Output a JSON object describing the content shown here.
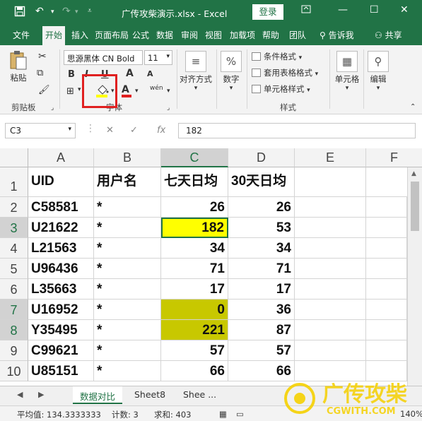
{
  "window": {
    "title": "广传攻柴演示.xlsx  -  Excel",
    "login_label": "登录",
    "undo_icon": "undo-icon",
    "redo_icon": "redo-icon"
  },
  "tabs": [
    "文件",
    "开始",
    "插入",
    "页面布局",
    "公式",
    "数据",
    "审阅",
    "视图",
    "加载项",
    "帮助",
    "团队"
  ],
  "tell_me": "告诉我",
  "share": "共享",
  "ribbon": {
    "paste": "粘贴",
    "clipboard_group": "剪贴板",
    "font_name": "思源黑体 CN Bold",
    "font_size": "11",
    "bold": "B",
    "italic": "I",
    "underline": "U",
    "font_group": "字体",
    "align_label": "对齐方式",
    "number_label": "数字",
    "number_symbol": "%",
    "conditional_format": "条件格式",
    "table_format": "套用表格格式",
    "cell_styles": "单元格样式",
    "styles_group": "样式",
    "cells_label": "单元格",
    "edit_label": "编辑",
    "wen": "wén",
    "highlight_color": "#ffff00",
    "font_color": "#e02020"
  },
  "formula_bar": {
    "name_box": "C3",
    "formula": "182",
    "fx": "fx"
  },
  "columns": [
    "A",
    "B",
    "C",
    "D",
    "E",
    "F"
  ],
  "rows": [
    "1",
    "2",
    "3",
    "4",
    "5",
    "6",
    "7",
    "8",
    "9",
    "10"
  ],
  "table": {
    "header": [
      "UID",
      "用户名",
      "七天日均",
      "30天日均"
    ],
    "data": [
      [
        "C58581",
        "*",
        "26",
        "26"
      ],
      [
        "U21622",
        "*",
        "182",
        "53"
      ],
      [
        "L21563",
        "*",
        "34",
        "34"
      ],
      [
        "U96436",
        "*",
        "71",
        "71"
      ],
      [
        "L35663",
        "*",
        "17",
        "17"
      ],
      [
        "U16952",
        "*",
        "0",
        "36"
      ],
      [
        "Y35495",
        "*",
        "221",
        "87"
      ],
      [
        "C99621",
        "*",
        "57",
        "57"
      ],
      [
        "U85151",
        "*",
        "66",
        "66"
      ]
    ]
  },
  "sheets": [
    "数据对比",
    "Sheet8",
    "Shee ..."
  ],
  "status": {
    "average": "平均值: 134.3333333",
    "count": "计数: 3",
    "sum": "求和: 403",
    "zoom": "140%"
  },
  "watermark": {
    "text": "广传攻柴",
    "url": "CGWITH.COM"
  },
  "colors": {
    "excel_green": "#217346",
    "cell_yellow": "#ffff00",
    "cell_olive": "#c8c800"
  }
}
